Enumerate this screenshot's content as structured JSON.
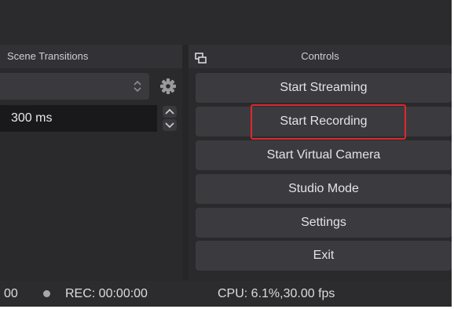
{
  "scene_transitions": {
    "title": "Scene Transitions",
    "selected_transition": "",
    "duration": "300 ms"
  },
  "controls": {
    "title": "Controls",
    "buttons": [
      {
        "label": "Start Streaming"
      },
      {
        "label": "Start Recording"
      },
      {
        "label": "Start Virtual Camera"
      },
      {
        "label": "Studio Mode"
      },
      {
        "label": "Settings"
      },
      {
        "label": "Exit"
      }
    ]
  },
  "status_bar": {
    "stream_fragment": "00",
    "rec": "REC: 00:00:00",
    "cpu": "CPU: 6.1%,30.00 fps"
  },
  "colors": {
    "highlight": "#e0262b",
    "background": "#2a2a2d",
    "button": "#3b3b3f"
  },
  "icons": [
    "float-dock-icon",
    "gear-icon",
    "select-arrows-icon",
    "spin-up-icon",
    "spin-down-icon",
    "record-dot-icon"
  ]
}
